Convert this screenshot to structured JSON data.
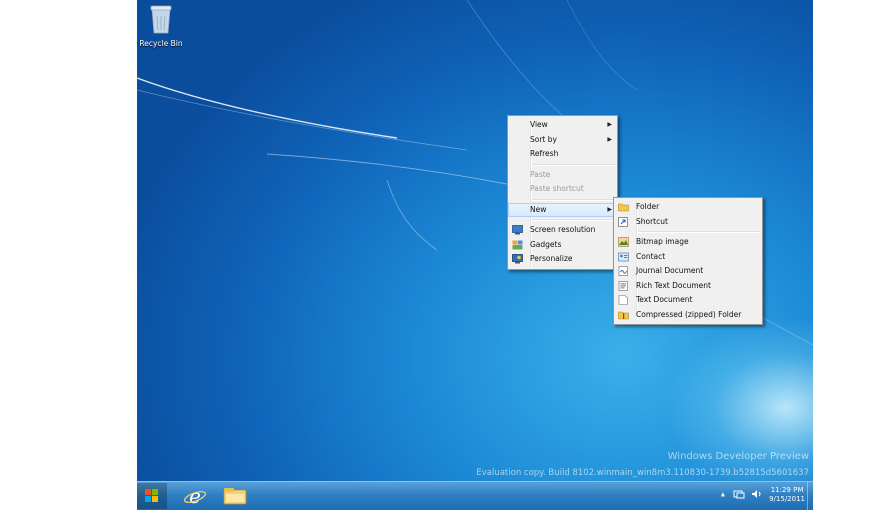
{
  "desktop": {
    "icons": [
      {
        "label": "Recycle Bin",
        "icon": "recycle-bin-icon"
      }
    ],
    "watermark": {
      "title": "Windows Developer Preview",
      "build": "Evaluation copy. Build 8102.winmain_win8m3.110830-1739.b52815d5601637"
    },
    "colors": {
      "background": "#1c8ad6",
      "taskbar": "#2f7fc2"
    }
  },
  "context_menu": {
    "items": [
      {
        "label": "View",
        "submenu": true
      },
      {
        "label": "Sort by",
        "submenu": true
      },
      {
        "label": "Refresh"
      },
      {
        "label": "Paste",
        "disabled": true
      },
      {
        "label": "Paste shortcut",
        "disabled": true
      },
      {
        "label": "New",
        "submenu": true,
        "highlighted": true
      },
      {
        "label": "Screen resolution",
        "icon": "monitor-icon"
      },
      {
        "label": "Gadgets",
        "icon": "gadgets-icon"
      },
      {
        "label": "Personalize",
        "icon": "personalize-icon"
      }
    ]
  },
  "new_submenu": {
    "items": [
      {
        "label": "Folder",
        "icon": "folder-icon"
      },
      {
        "label": "Shortcut",
        "icon": "shortcut-icon"
      },
      {
        "label": "Bitmap image",
        "icon": "bitmap-icon"
      },
      {
        "label": "Contact",
        "icon": "contact-icon"
      },
      {
        "label": "Journal Document",
        "icon": "journal-icon"
      },
      {
        "label": "Rich Text Document",
        "icon": "rich-text-icon"
      },
      {
        "label": "Text Document",
        "icon": "text-document-icon"
      },
      {
        "label": "Compressed (zipped) Folder",
        "icon": "zip-folder-icon"
      }
    ]
  },
  "taskbar": {
    "pinned": [
      "start-button-icon",
      "internet-explorer-icon",
      "file-explorer-icon"
    ],
    "tray": {
      "chevron": "▴",
      "network_icon": "network-icon",
      "volume_icon": "volume-icon"
    },
    "clock": {
      "time": "11:29 PM",
      "date": "9/15/2011"
    }
  }
}
